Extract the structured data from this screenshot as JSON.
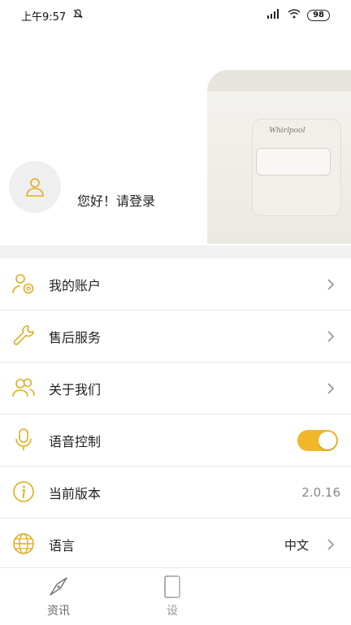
{
  "status_bar": {
    "time": "上午9:57",
    "battery": "98",
    "icons": [
      "mute-icon",
      "signal-icon",
      "wifi-icon",
      "battery-icon"
    ]
  },
  "profile": {
    "greeting": "您好！请登录",
    "hero_brand": "Whirlpool"
  },
  "menu": {
    "items": [
      {
        "label": "我的账户",
        "icon": "account-settings-icon",
        "trailing": "chevron"
      },
      {
        "label": "售后服务",
        "icon": "wrench-icon",
        "trailing": "chevron"
      },
      {
        "label": "关于我们",
        "icon": "people-icon",
        "trailing": "chevron"
      },
      {
        "label": "语音控制",
        "icon": "microphone-icon",
        "trailing": "toggle",
        "toggle_on": true
      },
      {
        "label": "当前版本",
        "icon": "info-icon",
        "trailing": "value",
        "value": "2.0.16"
      },
      {
        "label": "语言",
        "icon": "globe-icon",
        "trailing": "value-chevron",
        "value": "中文"
      }
    ]
  },
  "tab_bar": {
    "tabs": [
      {
        "label": "资讯",
        "icon": "compass-icon"
      },
      {
        "label": "设",
        "icon": "device-icon"
      }
    ]
  },
  "colors": {
    "accent": "#f0b829",
    "icon": "#e0ad1f",
    "background_band": "#f2f2f2"
  }
}
